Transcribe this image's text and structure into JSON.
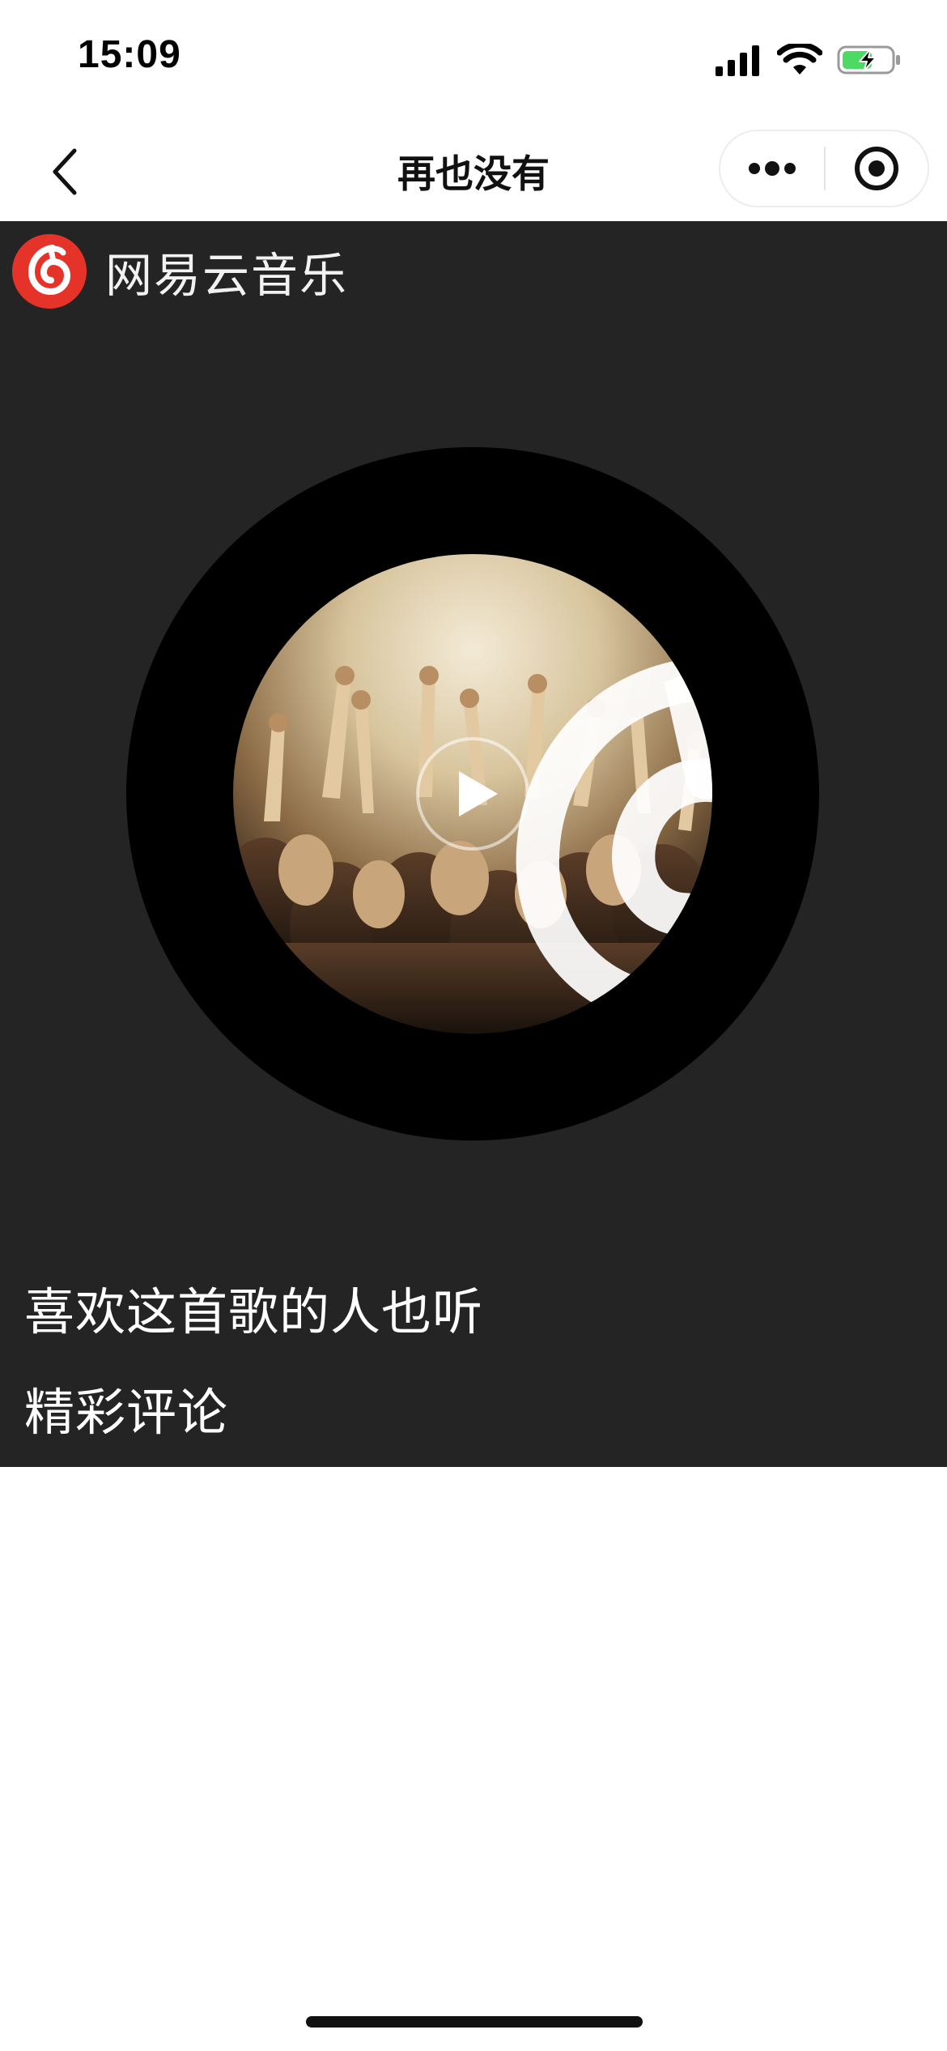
{
  "status_bar": {
    "time": "15:09",
    "icons": [
      "signal-icon",
      "wifi-icon",
      "battery-charging-icon"
    ]
  },
  "nav": {
    "title": "再也没有",
    "back_icon": "chevron-left-icon",
    "more_icon": "more-dots-icon",
    "close_icon": "mini-program-close-icon"
  },
  "brand": {
    "name": "网易云音乐",
    "logo_icon": "netease-cloud-music-logo",
    "color": "#e5332a"
  },
  "player": {
    "cover_icon": "album-cover-concert-crowd",
    "play_icon": "play-icon"
  },
  "sections": {
    "similar_listeners": "喜欢这首歌的人也听",
    "hot_comments": "精彩评论"
  },
  "colors": {
    "content_background": "#242424",
    "disc": "#000000",
    "text": "#ffffff"
  }
}
